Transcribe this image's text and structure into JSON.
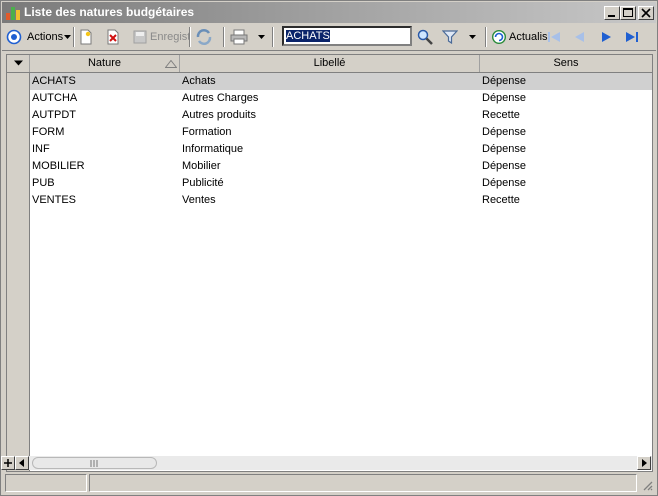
{
  "window": {
    "title": "Liste des natures budgétaires"
  },
  "toolbar": {
    "actions_label": "Actions",
    "save_label": "Enregist",
    "refresh_label": "Actualis",
    "search_value": "ACHATS"
  },
  "grid": {
    "columns": [
      "Nature",
      "Libellé",
      "Sens"
    ],
    "rows": [
      {
        "nature": "ACHATS",
        "libelle": "Achats",
        "sens": "Dépense"
      },
      {
        "nature": "AUTCHA",
        "libelle": "Autres Charges",
        "sens": "Dépense"
      },
      {
        "nature": "AUTPDT",
        "libelle": "Autres produits",
        "sens": "Recette"
      },
      {
        "nature": "FORM",
        "libelle": "Formation",
        "sens": "Dépense"
      },
      {
        "nature": "INF",
        "libelle": "Informatique",
        "sens": "Dépense"
      },
      {
        "nature": "MOBILIER",
        "libelle": "Mobilier",
        "sens": "Dépense"
      },
      {
        "nature": "PUB",
        "libelle": "Publicité",
        "sens": "Dépense"
      },
      {
        "nature": "VENTES",
        "libelle": "Ventes",
        "sens": "Recette"
      }
    ]
  },
  "colors": {
    "title_gradient_start": "#7a7a7a",
    "title_gradient_end": "#c8c8c8",
    "selection": "#d0d0d0",
    "nav_blue": "#1f5fd1"
  }
}
